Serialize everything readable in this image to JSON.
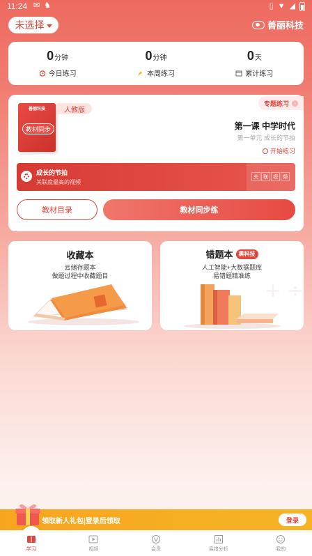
{
  "status_bar": {
    "time": "11:24"
  },
  "header": {
    "selector_label": "未选择",
    "brand_name": "善丽科技"
  },
  "stats": [
    {
      "value": "0",
      "unit": "分钟",
      "label": "今日练习",
      "icon": "alarm-clock-icon"
    },
    {
      "value": "0",
      "unit": "分钟",
      "label": "本周练习",
      "icon": "flexed-arm-icon"
    },
    {
      "value": "0",
      "unit": "天",
      "label": "累计练习",
      "icon": "calendar-icon"
    }
  ],
  "textbook": {
    "cover_brand": "善丽科技",
    "cover_tag": "教材同步",
    "edition": "人教版",
    "special_practice": "专题练习",
    "lesson_title": "第一课 中学时代",
    "lesson_subtitle": "第一单元 成长的节拍",
    "start_label": "开始练习",
    "video": {
      "title": "成长的节拍",
      "subtitle": "关联度最高的视频",
      "chars": [
        "关",
        "联",
        "视",
        "频"
      ]
    },
    "catalog_button": "教材目录",
    "sync_button": "教材同步练"
  },
  "favorites": {
    "title": "收藏本",
    "line1": "云储存题本",
    "line2": "做题过程中收藏题目"
  },
  "mistakes": {
    "title": "错题本",
    "badge": "黑科技",
    "line1": "人工智能+大数据题库",
    "line2": "易错题精准练"
  },
  "gift": {
    "text": "领取新人礼包|登录后领取",
    "login_label": "登录"
  },
  "tabs": [
    {
      "label": "学习",
      "icon": "book-icon",
      "active": true
    },
    {
      "label": "视频",
      "icon": "play-icon",
      "active": false
    },
    {
      "label": "会员",
      "icon": "vip-icon",
      "active": false
    },
    {
      "label": "易错分析",
      "icon": "bar-chart-icon",
      "active": false
    },
    {
      "label": "我的",
      "icon": "smiley-icon",
      "active": false
    }
  ],
  "colors": {
    "accent": "#e0463d",
    "gift_bar": "#f7a51f"
  }
}
